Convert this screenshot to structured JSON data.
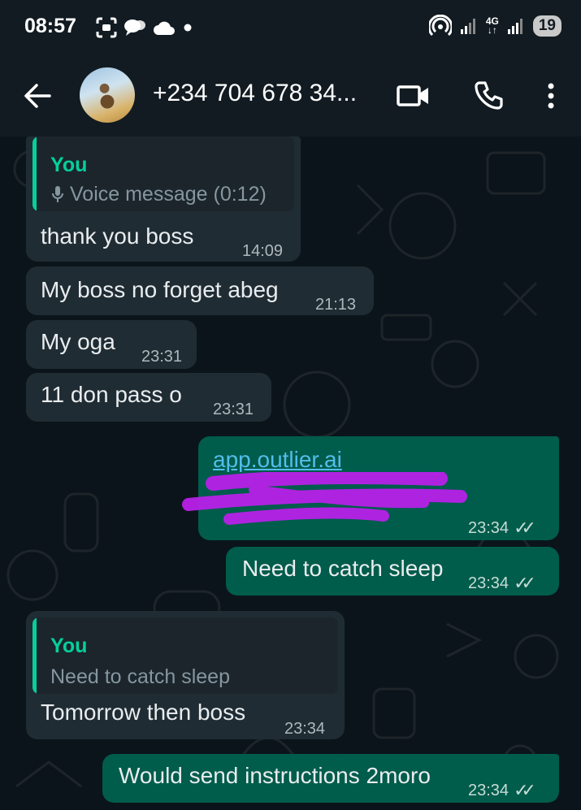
{
  "status_bar": {
    "time": "08:57",
    "network_label_top": "4G",
    "network_label_bottom": "↓↑",
    "battery": "19"
  },
  "header": {
    "contact_name": "+234 704 678 34..."
  },
  "messages": [
    {
      "direction": "in",
      "quote_author": "You",
      "quote_text": "Voice message (0:12)",
      "text": "thank you boss",
      "time": "14:09"
    },
    {
      "direction": "in",
      "text": "My boss no forget abeg",
      "time": "21:13"
    },
    {
      "direction": "in",
      "text": "My oga",
      "time": "23:31"
    },
    {
      "direction": "in",
      "text": "11 don pass o",
      "time": "23:31"
    },
    {
      "direction": "out",
      "text": "app.outlier.ai",
      "time": "23:34",
      "status": "read"
    },
    {
      "direction": "out",
      "text": "Need to catch sleep",
      "time": "23:34",
      "status": "read"
    },
    {
      "direction": "in",
      "quote_author": "You",
      "quote_text": "Need to catch sleep",
      "text": "Tomorrow then boss",
      "time": "23:34"
    },
    {
      "direction": "out",
      "text": "Would send instructions 2moro",
      "time": "23:34",
      "status": "read"
    }
  ],
  "colors": {
    "incoming_bubble": "#202c33",
    "outgoing_bubble": "#005c4b",
    "accent": "#06cf9c",
    "link": "#53bdeb",
    "redaction": "#b820e8"
  }
}
